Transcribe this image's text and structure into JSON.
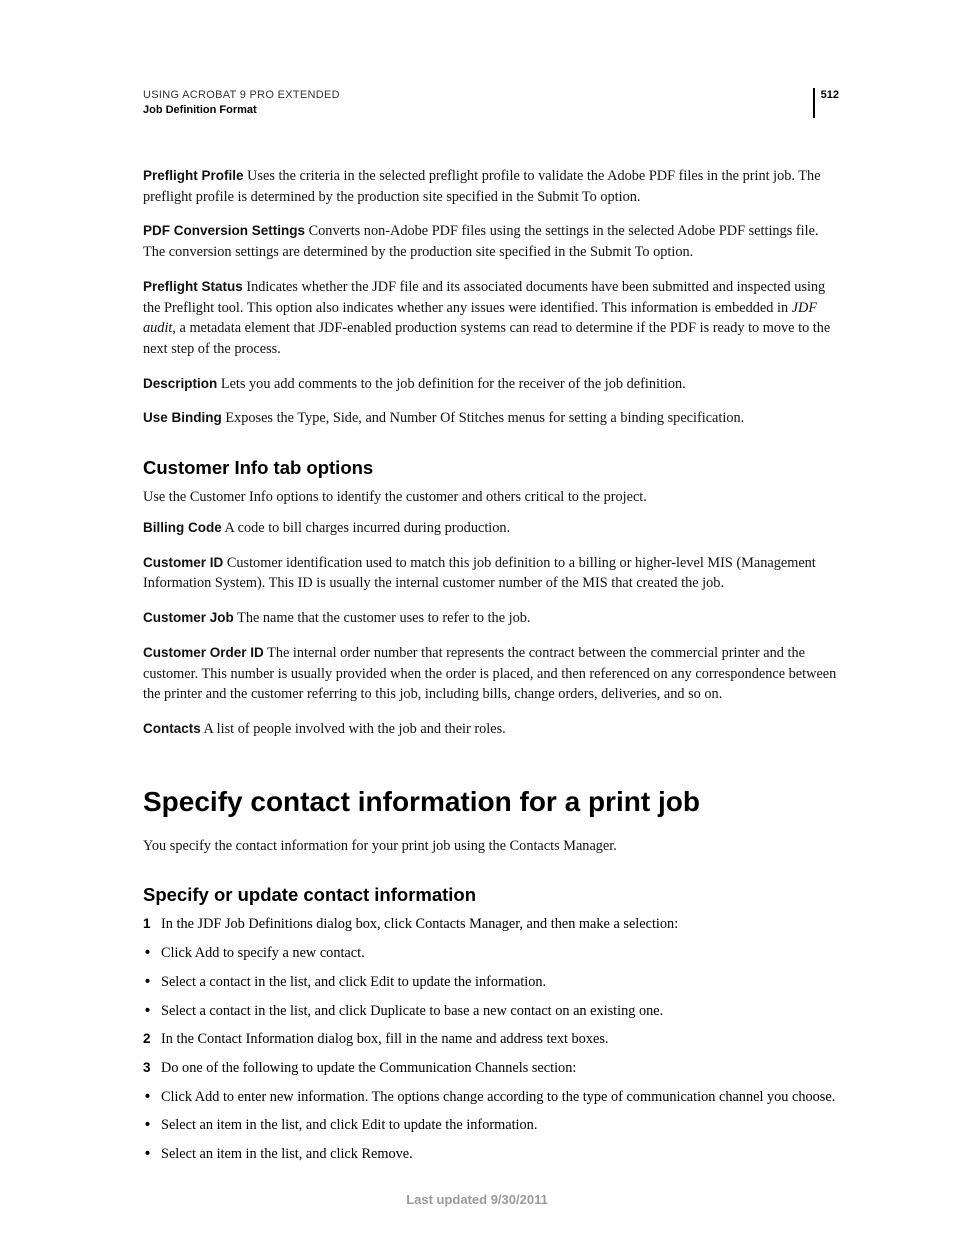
{
  "header": {
    "line1": "USING ACROBAT 9 PRO EXTENDED",
    "line2": "Job Definition Format",
    "page_number": "512"
  },
  "definitions_top": [
    {
      "term": "Preflight Profile",
      "text": " Uses the criteria in the selected preflight profile to validate the Adobe PDF files in the print job. The preflight profile is determined by the production site specified in the Submit To option."
    },
    {
      "term": "PDF Conversion Settings",
      "text": " Converts non-Adobe PDF files using the settings in the selected Adobe PDF settings file. The conversion settings are determined by the production site specified in the Submit To option."
    },
    {
      "term": "Preflight Status",
      "text_before_ital": " Indicates whether the JDF file and its associated documents have been submitted and inspected using the Preflight tool. This option also indicates whether any issues were identified. This information is embedded in ",
      "ital": "JDF audit",
      "text_after_ital": ", a metadata element that JDF-enabled production systems can read to determine if the PDF is ready to move to the next step of the process."
    },
    {
      "term": "Description",
      "text": " Lets you add comments to the job definition for the receiver of the job definition."
    },
    {
      "term": "Use Binding",
      "text": " Exposes the Type, Side, and Number Of Stitches menus for setting a binding specification."
    }
  ],
  "section_customer": {
    "heading": "Customer Info tab options",
    "intro": "Use the Customer Info options to identify the customer and others critical to the project.",
    "items": [
      {
        "term": "Billing Code",
        "text": " A code to bill charges incurred during production."
      },
      {
        "term": "Customer ID",
        "text": " Customer identification used to match this job definition to a billing or higher-level MIS (Management Information System). This ID is usually the internal customer number of the MIS that created the job."
      },
      {
        "term": "Customer Job",
        "text": " The name that the customer uses to refer to the job."
      },
      {
        "term": "Customer Order ID",
        "text": " The internal order number that represents the contract between the commercial printer and the customer. This number is usually provided when the order is placed, and then referenced on any correspondence between the printer and the customer referring to this job, including bills, change orders, deliveries, and so on."
      },
      {
        "term": "Contacts",
        "text": " A list of people involved with the job and their roles."
      }
    ]
  },
  "chapter": {
    "title": "Specify contact information for a print job",
    "intro": "You specify the contact information for your print job using the Contacts Manager."
  },
  "section_specify": {
    "heading": "Specify or update contact information",
    "steps": [
      {
        "marker": "1",
        "text": "In the JDF Job Definitions dialog box, click Contacts Manager, and then make a selection:"
      },
      {
        "marker": "•",
        "text": "Click Add to specify a new contact."
      },
      {
        "marker": "•",
        "text": "Select a contact in the list, and click Edit to update the information."
      },
      {
        "marker": "•",
        "text": "Select a contact in the list, and click Duplicate to base a new contact on an existing one."
      },
      {
        "marker": "2",
        "text": "In the Contact Information dialog box, fill in the name and address text boxes."
      },
      {
        "marker": "3",
        "text": "Do one of the following to update the Communication Channels section:"
      },
      {
        "marker": "•",
        "text": "Click Add to enter new information. The options change according to the type of communication channel you choose."
      },
      {
        "marker": "•",
        "text": "Select an item in the list, and click Edit to update the information."
      },
      {
        "marker": "•",
        "text": "Select an item in the list, and click Remove."
      }
    ]
  },
  "footer": "Last updated 9/30/2011"
}
